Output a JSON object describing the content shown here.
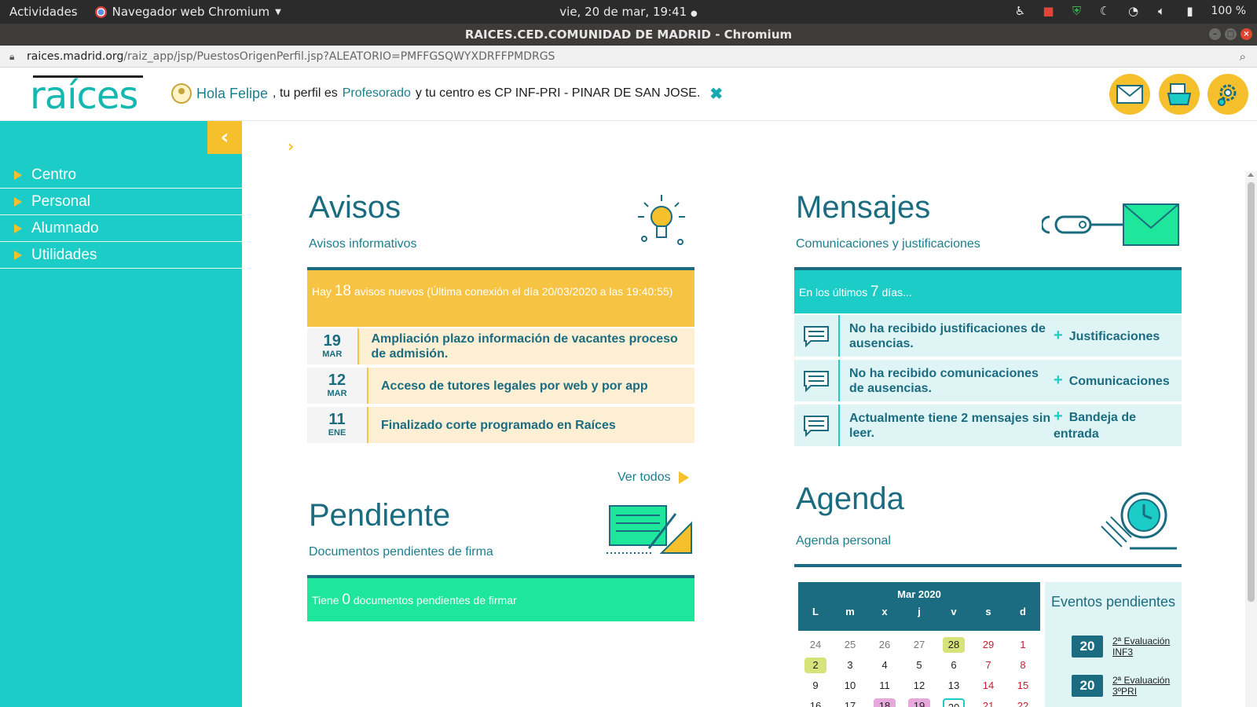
{
  "system_bar": {
    "activities": "Actividades",
    "app_name": "Navegador web Chromium",
    "datetime": "vie, 20 de mar, 19:41",
    "battery": "100 %"
  },
  "window": {
    "title": "RAICES.CED.COMUNIDAD DE MADRID - Chromium"
  },
  "address_bar": {
    "domain": "raices.madrid.org",
    "path": "/raiz_app/jsp/PuestosOrigenPerfil.jsp?ALEATORIO=PMFFGSQWYXDRFFPMDRGS"
  },
  "header": {
    "logo_text": "raíces",
    "greeting_hello": "Hola Felipe",
    "greeting_profile_prefix": ", tu perfil es",
    "profile": "Profesorado",
    "greeting_center": "y tu centro es CP INF-PRI - PINAR DE SAN JOSE."
  },
  "sidebar": {
    "items": [
      {
        "label": "Centro"
      },
      {
        "label": "Personal"
      },
      {
        "label": "Alumnado"
      },
      {
        "label": "Utilidades"
      }
    ]
  },
  "avisos": {
    "title": "Avisos",
    "subtitle": "Avisos informativos",
    "banner_prefix": "Hay",
    "banner_count": "18",
    "banner_suffix": "avisos nuevos (Última conexión el día 20/03/2020 a las 19:40:55)",
    "items": [
      {
        "day": "19",
        "month": "MAR",
        "text": "Ampliación plazo información de vacantes proceso de admisión."
      },
      {
        "day": "12",
        "month": "MAR",
        "text": "Acceso de tutores legales por web y por app"
      },
      {
        "day": "11",
        "month": "ENE",
        "text": "Finalizado corte programado en Raíces"
      }
    ],
    "ver_todos": "Ver todos"
  },
  "pendiente": {
    "title": "Pendiente",
    "subtitle": "Documentos pendientes de firma",
    "banner_prefix": "Tiene",
    "banner_count": "0",
    "banner_suffix": "documentos pendientes de firmar"
  },
  "mensajes": {
    "title": "Mensajes",
    "subtitle": "Comunicaciones y justificaciones",
    "banner_prefix": "En los últimos",
    "banner_count": "7",
    "banner_suffix": "días...",
    "rows": [
      {
        "text": "No ha recibido justificaciones de ausencias.",
        "link": "Justificaciones"
      },
      {
        "text": "No ha recibido comunicaciones de ausencias.",
        "link": "Comunicaciones"
      },
      {
        "text": "Actualmente tiene 2 mensajes sin leer.",
        "link": "Bandeja de entrada"
      }
    ]
  },
  "agenda": {
    "title": "Agenda",
    "subtitle": "Agenda personal",
    "calendar": {
      "month": "Mar 2020",
      "dows": [
        "L",
        "m",
        "x",
        "j",
        "v",
        "s",
        "d"
      ],
      "days": [
        {
          "d": "24",
          "cls": "other"
        },
        {
          "d": "25",
          "cls": "other"
        },
        {
          "d": "26",
          "cls": "other"
        },
        {
          "d": "27",
          "cls": "other"
        },
        {
          "d": "28",
          "cls": "hl-green"
        },
        {
          "d": "29",
          "cls": "weekend"
        },
        {
          "d": "1",
          "cls": "weekend"
        },
        {
          "d": "2",
          "cls": "hl-green"
        },
        {
          "d": "3",
          "cls": ""
        },
        {
          "d": "4",
          "cls": ""
        },
        {
          "d": "5",
          "cls": ""
        },
        {
          "d": "6",
          "cls": ""
        },
        {
          "d": "7",
          "cls": "weekend"
        },
        {
          "d": "8",
          "cls": "weekend"
        },
        {
          "d": "9",
          "cls": ""
        },
        {
          "d": "10",
          "cls": ""
        },
        {
          "d": "11",
          "cls": ""
        },
        {
          "d": "12",
          "cls": ""
        },
        {
          "d": "13",
          "cls": ""
        },
        {
          "d": "14",
          "cls": "weekend"
        },
        {
          "d": "15",
          "cls": "weekend"
        },
        {
          "d": "16",
          "cls": ""
        },
        {
          "d": "17",
          "cls": ""
        },
        {
          "d": "18",
          "cls": "hl-pink"
        },
        {
          "d": "19",
          "cls": "hl-pink"
        },
        {
          "d": "20",
          "cls": "today"
        },
        {
          "d": "21",
          "cls": "weekend"
        },
        {
          "d": "22",
          "cls": "weekend"
        }
      ]
    },
    "eventos_title": "Eventos pendientes",
    "eventos": [
      {
        "day": "20",
        "label": "2ª Evaluación INF3"
      },
      {
        "day": "20",
        "label": "2ª Evaluación 3ºPRI"
      }
    ]
  },
  "colors": {
    "teal": "#1bcdc6",
    "dark_teal": "#1b6c80",
    "yellow": "#f6bf2c",
    "green": "#1ee69a"
  }
}
